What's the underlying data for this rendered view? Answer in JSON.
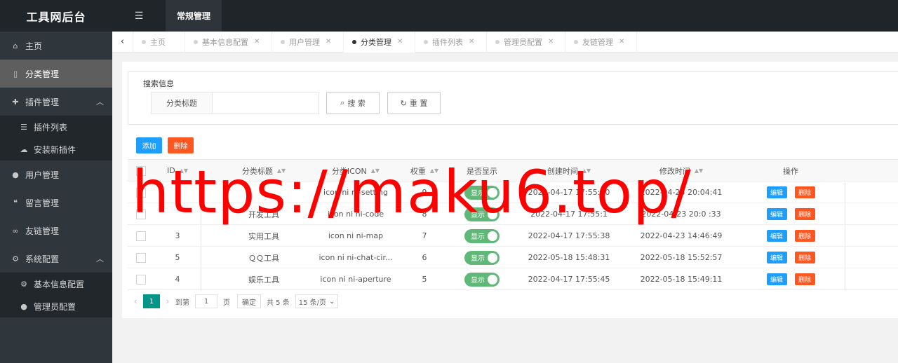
{
  "app": {
    "title": "工具网后台"
  },
  "sidebar": {
    "items": [
      {
        "label": "主页",
        "icon": "home-icon"
      },
      {
        "label": "分类管理",
        "icon": "bookmark-icon",
        "active": true
      },
      {
        "label": "插件管理",
        "icon": "puzzle-icon",
        "expanded": true,
        "children": [
          {
            "label": "插件列表",
            "icon": "list-icon"
          },
          {
            "label": "安装新插件",
            "icon": "cloud-upload-icon"
          }
        ]
      },
      {
        "label": "用户管理",
        "icon": "user-icon"
      },
      {
        "label": "留言管理",
        "icon": "comments-icon"
      },
      {
        "label": "友链管理",
        "icon": "link-icon"
      },
      {
        "label": "系统配置",
        "icon": "gears-icon",
        "expanded": true,
        "children": [
          {
            "label": "基本信息配置",
            "icon": "gear-icon"
          },
          {
            "label": "管理员配置",
            "icon": "user-icon"
          }
        ]
      }
    ]
  },
  "topbar": {
    "menu_icon": "indent-icon",
    "active_tab": "常规管理"
  },
  "tabs": [
    {
      "label": "主页",
      "closable": false
    },
    {
      "label": "基本信息配置",
      "closable": true
    },
    {
      "label": "用户管理",
      "closable": true
    },
    {
      "label": "分类管理",
      "closable": true,
      "active": true
    },
    {
      "label": "插件列表",
      "closable": true
    },
    {
      "label": "管理员配置",
      "closable": true
    },
    {
      "label": "友链管理",
      "closable": true
    }
  ],
  "search": {
    "legend": "搜索信息",
    "field_label": "分类标题",
    "field_value": "",
    "search_button": "搜 索",
    "reset_button": "重 置"
  },
  "toolbar": {
    "add_label": "添加",
    "delete_label": "删除"
  },
  "table": {
    "columns": [
      "ID",
      "分类标题",
      "分类ICON",
      "权重",
      "是否显示",
      "创建时间",
      "修改时间",
      "操作"
    ],
    "rows": [
      {
        "id": "",
        "title": "",
        "icon": "icon ni ni-setting",
        "weight": "9",
        "show": "显示",
        "created": "2022-04-17 17:55:20",
        "modified": "2022-04-23 20:04:41"
      },
      {
        "id": "",
        "title": "开发工具",
        "icon": "icon ni ni-code",
        "weight": "8",
        "show": "显示",
        "created": "2022-04-17 17:55:1",
        "modified": "2022-04-23 20:0 :33"
      },
      {
        "id": "3",
        "title": "实用工具",
        "icon": "icon ni ni-map",
        "weight": "7",
        "show": "显示",
        "created": "2022-04-17 17:55:38",
        "modified": "2022-04-23 14:46:49"
      },
      {
        "id": "5",
        "title": "ＱＱ工具",
        "icon": "icon ni ni-chat-cir...",
        "weight": "6",
        "show": "显示",
        "created": "2022-05-18 15:48:31",
        "modified": "2022-05-18 15:52:57"
      },
      {
        "id": "4",
        "title": "娱乐工具",
        "icon": "icon ni ni-aperture",
        "weight": "5",
        "show": "显示",
        "created": "2022-04-17 17:55:45",
        "modified": "2022-05-18 15:49:11"
      }
    ],
    "edit_label": "编辑",
    "delete_label": "删除"
  },
  "pager": {
    "current_page": "1",
    "goto_label": "到第",
    "goto_value": "1",
    "page_label": "页",
    "confirm_label": "确定",
    "total_label": "共 5 条",
    "per_page": "15 条/页"
  },
  "watermark": "https://maku6.top/",
  "colors": {
    "sidebar_bg": "#2f363c",
    "topbar_bg": "#20252a",
    "primary_blue": "#1e9fff",
    "danger_orange": "#ff5722",
    "switch_green": "#5fb878",
    "pager_teal": "#009688",
    "watermark_red": "#ff0000"
  }
}
